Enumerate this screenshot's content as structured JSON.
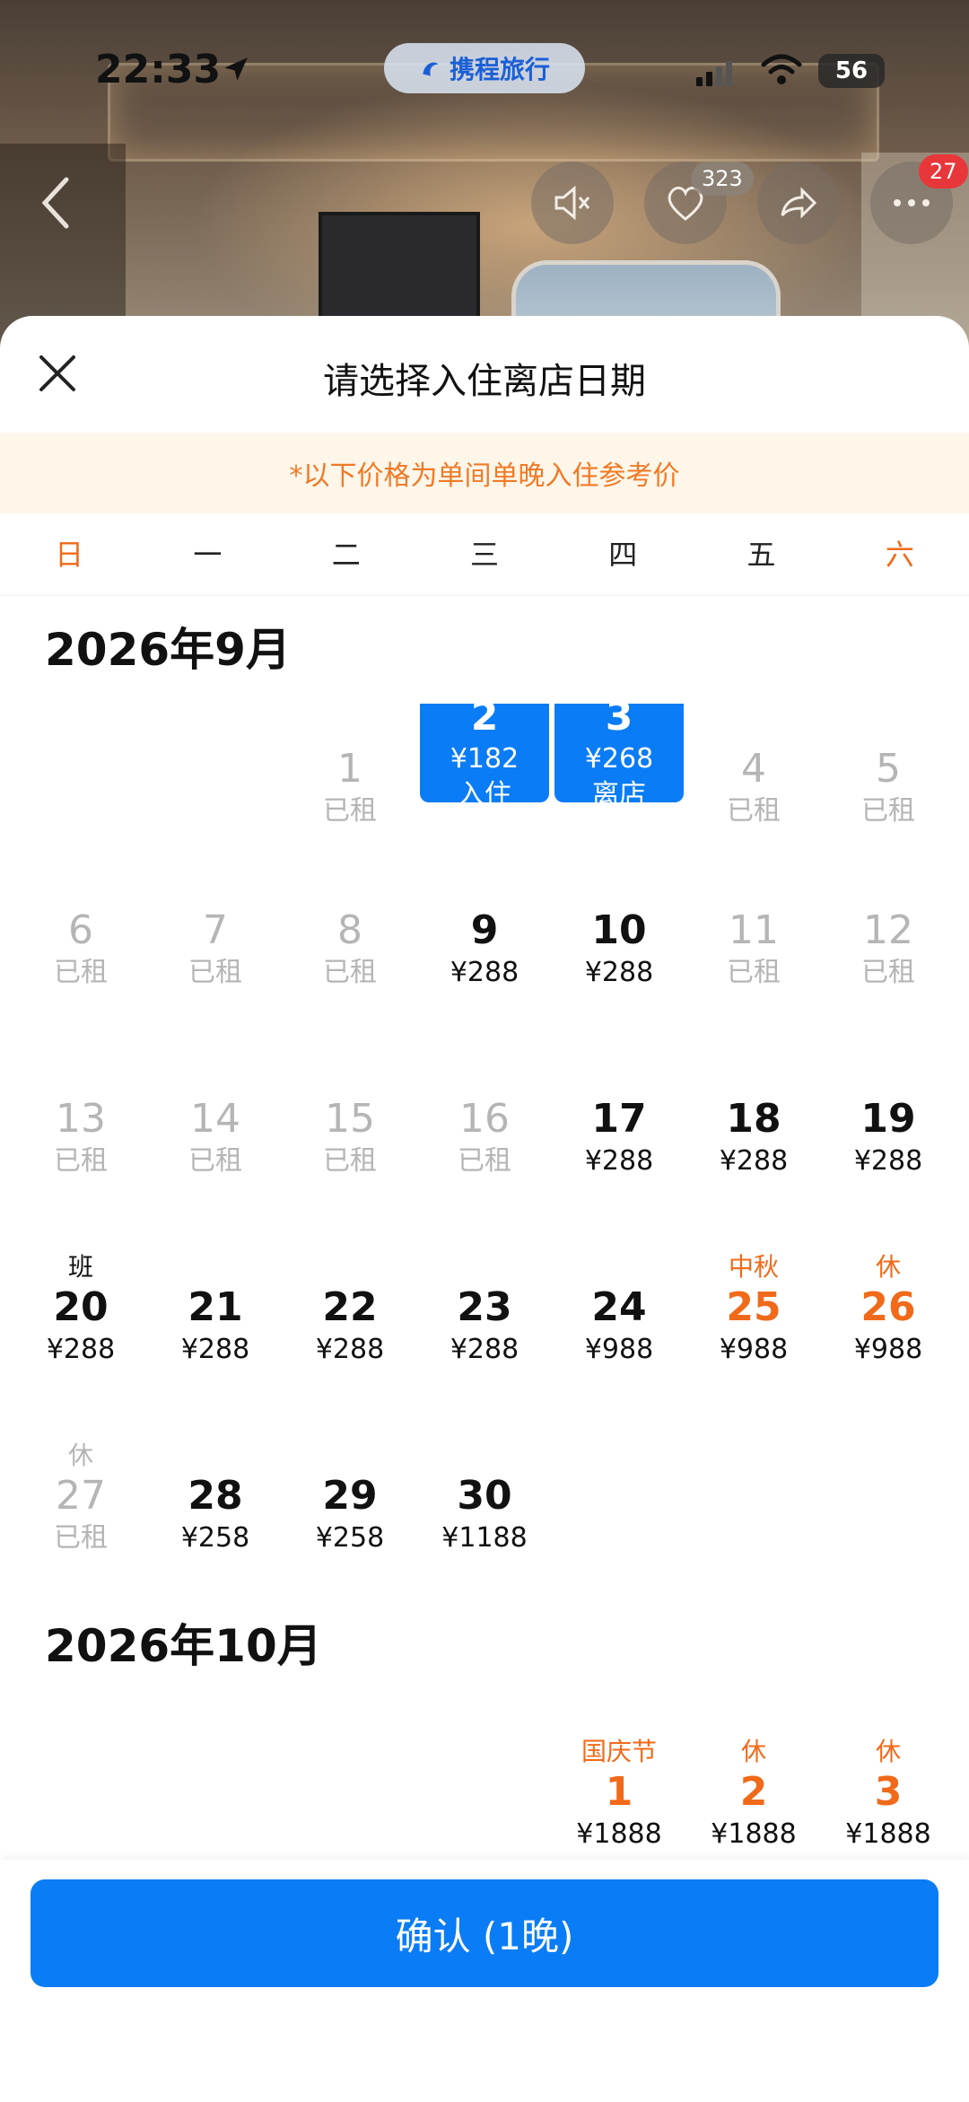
{
  "status_bar": {
    "time": "22:33",
    "app_name": "携程旅行",
    "battery": "56"
  },
  "hero": {
    "like_count": "323",
    "message_count": "27"
  },
  "sheet": {
    "title": "请选择入住离店日期",
    "notice": "*以下价格为单间单晚入住参考价"
  },
  "weekdays": [
    "日",
    "一",
    "二",
    "三",
    "四",
    "五",
    "六"
  ],
  "months": [
    {
      "title": "2026年9月",
      "rows": [
        [
          null,
          null,
          {
            "day": "1",
            "price": "已租",
            "status": "rented"
          },
          {
            "day": "2",
            "price": "¥182",
            "tag": "入住",
            "status": "selected"
          },
          {
            "day": "3",
            "price": "¥268",
            "tag": "离店",
            "status": "selected"
          },
          {
            "day": "4",
            "price": "已租",
            "status": "rented"
          },
          {
            "day": "5",
            "price": "已租",
            "status": "rented"
          }
        ],
        [
          {
            "day": "6",
            "price": "已租",
            "status": "rented"
          },
          {
            "day": "7",
            "price": "已租",
            "status": "rented"
          },
          {
            "day": "8",
            "price": "已租",
            "status": "rented"
          },
          {
            "day": "9",
            "price": "¥288",
            "status": "available"
          },
          {
            "day": "10",
            "price": "¥288",
            "status": "available"
          },
          {
            "day": "11",
            "price": "已租",
            "status": "rented"
          },
          {
            "day": "12",
            "price": "已租",
            "status": "rented"
          }
        ],
        [
          {
            "day": "13",
            "price": "已租",
            "status": "rented"
          },
          {
            "day": "14",
            "price": "已租",
            "status": "rented"
          },
          {
            "day": "15",
            "price": "已租",
            "status": "rented"
          },
          {
            "day": "16",
            "price": "已租",
            "status": "rented"
          },
          {
            "day": "17",
            "price": "¥288",
            "status": "available"
          },
          {
            "day": "18",
            "price": "¥288",
            "status": "available"
          },
          {
            "day": "19",
            "price": "¥288",
            "status": "available"
          }
        ],
        [
          {
            "day": "20",
            "price": "¥288",
            "tag": "班",
            "status": "available"
          },
          {
            "day": "21",
            "price": "¥288",
            "status": "available"
          },
          {
            "day": "22",
            "price": "¥288",
            "status": "available"
          },
          {
            "day": "23",
            "price": "¥288",
            "status": "available"
          },
          {
            "day": "24",
            "price": "¥988",
            "status": "available"
          },
          {
            "day": "25",
            "price": "¥988",
            "tag": "中秋",
            "status": "holiday"
          },
          {
            "day": "26",
            "price": "¥988",
            "tag": "休",
            "status": "holiday"
          }
        ],
        [
          {
            "day": "27",
            "price": "已租",
            "tag": "休",
            "status": "rented"
          },
          {
            "day": "28",
            "price": "¥258",
            "status": "available"
          },
          {
            "day": "29",
            "price": "¥258",
            "status": "available"
          },
          {
            "day": "30",
            "price": "¥1188",
            "status": "available"
          },
          null,
          null,
          null
        ]
      ]
    },
    {
      "title": "2026年10月",
      "rows": [
        [
          null,
          null,
          null,
          null,
          {
            "day": "1",
            "price": "¥1888",
            "tag": "国庆节",
            "status": "holiday"
          },
          {
            "day": "2",
            "price": "¥1888",
            "tag": "休",
            "status": "holiday"
          },
          {
            "day": "3",
            "price": "¥1888",
            "tag": "休",
            "status": "holiday"
          }
        ]
      ]
    }
  ],
  "footer": {
    "confirm_label": "确认 (1晚)"
  },
  "colors": {
    "primary": "#0a7cf5",
    "weekend": "#f06a1a",
    "rented": "#b5b5b5",
    "notice_bg": "#fff6ea"
  }
}
